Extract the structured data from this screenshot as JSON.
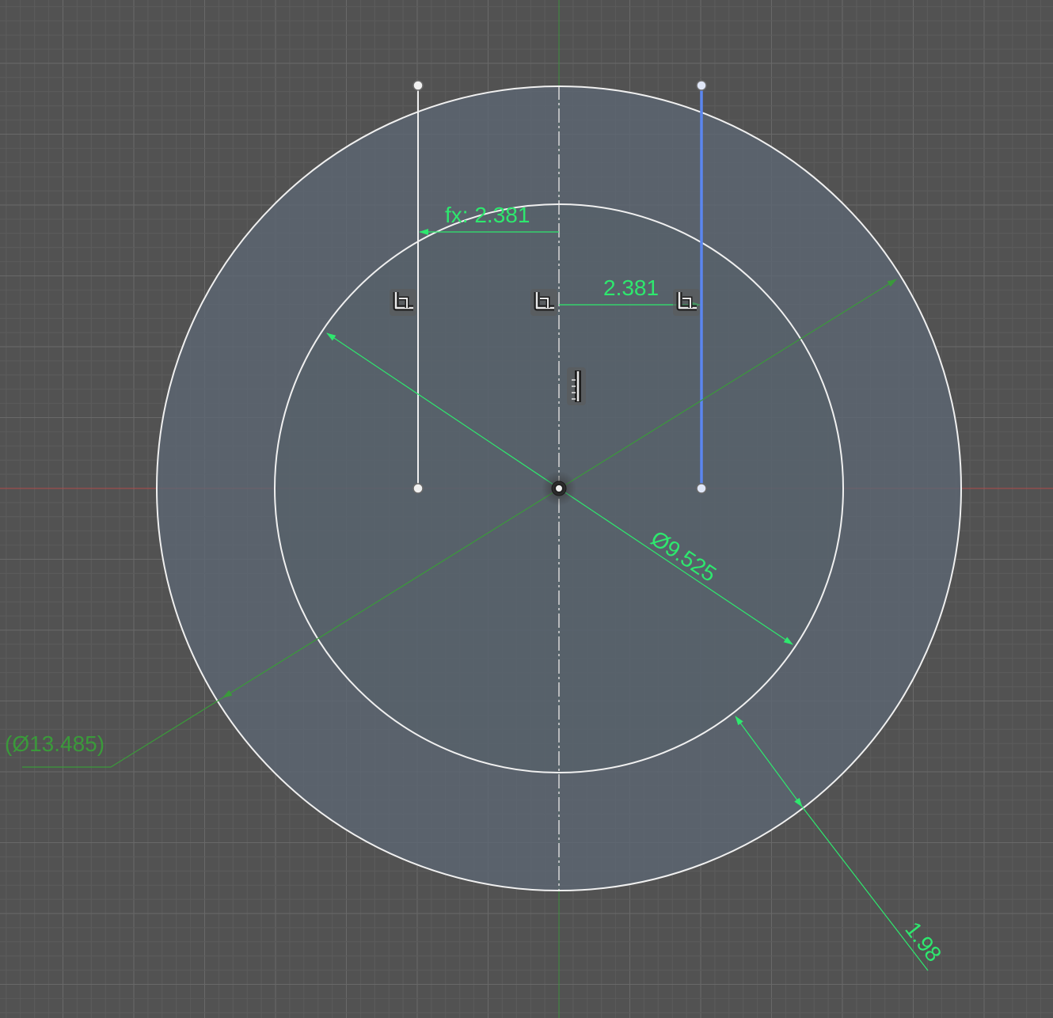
{
  "sketch": {
    "colors": {
      "background": "#525252",
      "grid_minor": "#5c5c5c",
      "grid_major": "#696969",
      "x_axis": "#b04a4a",
      "y_axis": "#3f8f3f",
      "profile_fill": "#5c6773",
      "geometry": "#f0f0f0",
      "selected": "#5b86f0",
      "dimension": "#2ee86e",
      "reference_dimension": "#3a9a3a"
    },
    "dimensions": {
      "offset_fx": "fx: 2.381",
      "offset": "2.381",
      "inner_diameter": "Ø9.525",
      "outer_diameter_reference": "(Ø13.485)",
      "ring_width": "1.98"
    },
    "constraint_icons": [
      "perpendicular-icon",
      "perpendicular-icon",
      "perpendicular-icon",
      "vertical-icon"
    ]
  }
}
